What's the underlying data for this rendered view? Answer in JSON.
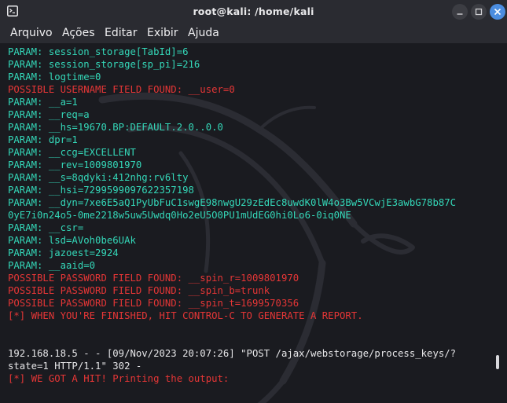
{
  "window": {
    "title": "root@kali: /home/kali",
    "icon": "terminal-icon",
    "controls": [
      "minimize-icon",
      "maximize-icon",
      "close-icon"
    ],
    "accent_color": "#4b8de0"
  },
  "menu": {
    "items": [
      "Arquivo",
      "Ações",
      "Editar",
      "Exibir",
      "Ajuda"
    ]
  },
  "colors": {
    "background": "#1a1b20",
    "param": "#34d7b8",
    "alert": "#e53636",
    "log": "#e6e6e8"
  },
  "terminal": {
    "lines": [
      {
        "text": "PARAM: session_storage[TabId]=6",
        "color": "teal"
      },
      {
        "text": "PARAM: session_storage[sp_pi]=216",
        "color": "teal"
      },
      {
        "text": "PARAM: logtime=0",
        "color": "teal"
      },
      {
        "text": "POSSIBLE USERNAME FIELD FOUND: __user=0",
        "color": "red"
      },
      {
        "text": "PARAM: __a=1",
        "color": "teal"
      },
      {
        "text": "PARAM: __req=a",
        "color": "teal"
      },
      {
        "text": "PARAM: __hs=19670.BP:DEFAULT.2.0..0.0",
        "color": "teal"
      },
      {
        "text": "PARAM: dpr=1",
        "color": "teal"
      },
      {
        "text": "PARAM: __ccg=EXCELLENT",
        "color": "teal"
      },
      {
        "text": "PARAM: __rev=1009801970",
        "color": "teal"
      },
      {
        "text": "PARAM: __s=8qdyki:412nhg:rv6lty",
        "color": "teal"
      },
      {
        "text": "PARAM: __hsi=7299599097622357198",
        "color": "teal"
      },
      {
        "text": "PARAM: __dyn=7xe6E5aQ1PyUbFuC1swgE98nwgU29zEdEc8uwdK0lW4o3Bw5VCwjE3awbG78b87C",
        "color": "teal"
      },
      {
        "text": "0yE7i0n24o5-0me2218w5uw5Uwdq0Ho2eU5O0PU1mUdEG0hi0Lo6-0iq0NE",
        "color": "teal"
      },
      {
        "text": "PARAM: __csr=",
        "color": "teal"
      },
      {
        "text": "PARAM: lsd=AVoh0be6UAk",
        "color": "teal"
      },
      {
        "text": "PARAM: jazoest=2924",
        "color": "teal"
      },
      {
        "text": "PARAM: __aaid=0",
        "color": "teal"
      },
      {
        "text": "POSSIBLE PASSWORD FIELD FOUND: __spin_r=1009801970",
        "color": "red"
      },
      {
        "text": "POSSIBLE PASSWORD FIELD FOUND: __spin_b=trunk",
        "color": "red"
      },
      {
        "text": "POSSIBLE PASSWORD FIELD FOUND: __spin_t=1699570356",
        "color": "red"
      },
      {
        "text": "[*] WHEN YOU'RE FINISHED, HIT CONTROL-C TO GENERATE A REPORT.",
        "color": "red"
      },
      {
        "text": "",
        "color": "white"
      },
      {
        "text": "",
        "color": "white"
      },
      {
        "text": "192.168.18.5 - - [09/Nov/2023 20:07:26] \"POST /ajax/webstorage/process_keys/?",
        "color": "white"
      },
      {
        "text": "state=1 HTTP/1.1\" 302 -",
        "color": "white"
      },
      {
        "text": "[*] WE GOT A HIT! Printing the output:",
        "color": "red"
      }
    ]
  }
}
